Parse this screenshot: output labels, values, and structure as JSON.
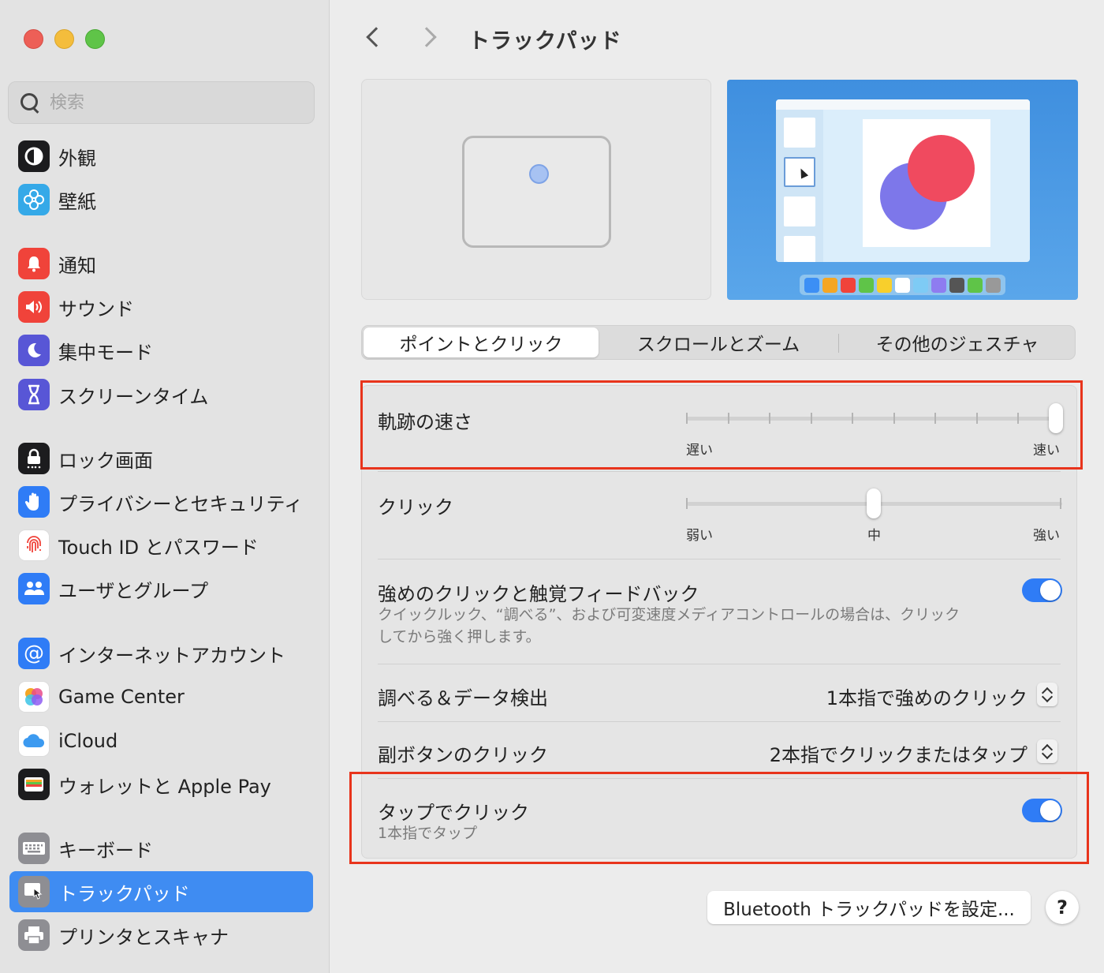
{
  "window": {
    "title": "トラックパッド"
  },
  "search": {
    "placeholder": "検索"
  },
  "sidebar": {
    "items": [
      {
        "label": "外観",
        "icon": "appearance-icon",
        "color": "#1c1c1e"
      },
      {
        "label": "壁紙",
        "icon": "wallpaper-icon",
        "color": "#35a9e8"
      },
      {
        "label": "通知",
        "icon": "bell-icon",
        "color": "#f0433a"
      },
      {
        "label": "サウンド",
        "icon": "speaker-icon",
        "color": "#f0433a"
      },
      {
        "label": "集中モード",
        "icon": "moon-icon",
        "color": "#5856d6"
      },
      {
        "label": "スクリーンタイム",
        "icon": "hourglass-icon",
        "color": "#5856d6"
      },
      {
        "label": "ロック画面",
        "icon": "lock-icon",
        "color": "#1c1c1e"
      },
      {
        "label": "プライバシーとセキュリティ",
        "icon": "hand-icon",
        "color": "#2f7cf6"
      },
      {
        "label": "Touch ID とパスワード",
        "icon": "fingerprint-icon",
        "color": "#ffffff"
      },
      {
        "label": "ユーザとグループ",
        "icon": "users-icon",
        "color": "#2f7cf6"
      },
      {
        "label": "インターネットアカウント",
        "icon": "at-icon",
        "color": "#2f7cf6"
      },
      {
        "label": "Game Center",
        "icon": "game-center-icon",
        "color": "#ffffff"
      },
      {
        "label": "iCloud",
        "icon": "cloud-icon",
        "color": "#ffffff"
      },
      {
        "label": "ウォレットと Apple Pay",
        "icon": "wallet-icon",
        "color": "#1c1c1e"
      },
      {
        "label": "キーボード",
        "icon": "keyboard-icon",
        "color": "#8e8e93"
      },
      {
        "label": "トラックパッド",
        "icon": "trackpad-icon",
        "color": "#8e8e93",
        "active": true
      },
      {
        "label": "プリンタとスキャナ",
        "icon": "printer-icon",
        "color": "#8e8e93"
      }
    ]
  },
  "tabs": [
    {
      "label": "ポイントとクリック",
      "active": true
    },
    {
      "label": "スクロールとズーム",
      "active": false
    },
    {
      "label": "その他のジェスチャ",
      "active": false
    }
  ],
  "settings": {
    "tracking_speed": {
      "label": "軌跡の速さ",
      "min_label": "遅い",
      "max_label": "速い",
      "value": 1.0,
      "ticks": 10
    },
    "click": {
      "label": "クリック",
      "min_label": "弱い",
      "mid_label": "中",
      "max_label": "強い",
      "value": 0.5
    },
    "force_click": {
      "label": "強めのクリックと触覚フィードバック",
      "description_line1": "クイックルック、“調べる”、および可変速度メディアコントロールの場合は、クリック",
      "description_line2": "してから強く押します。",
      "enabled": true
    },
    "lookup": {
      "label": "調べる＆データ検出",
      "value": "1本指で強めのクリック"
    },
    "secondary_click": {
      "label": "副ボタンのクリック",
      "value": "2本指でクリックまたはタップ"
    },
    "tap_to_click": {
      "label": "タップでクリック",
      "description": "1本指でタップ",
      "enabled": true
    }
  },
  "footer": {
    "bluetooth_button": "Bluetooth トラックパッドを設定...",
    "help_button": "?"
  },
  "colors": {
    "accent": "#2f7cf6",
    "highlight": "#e8341c"
  }
}
